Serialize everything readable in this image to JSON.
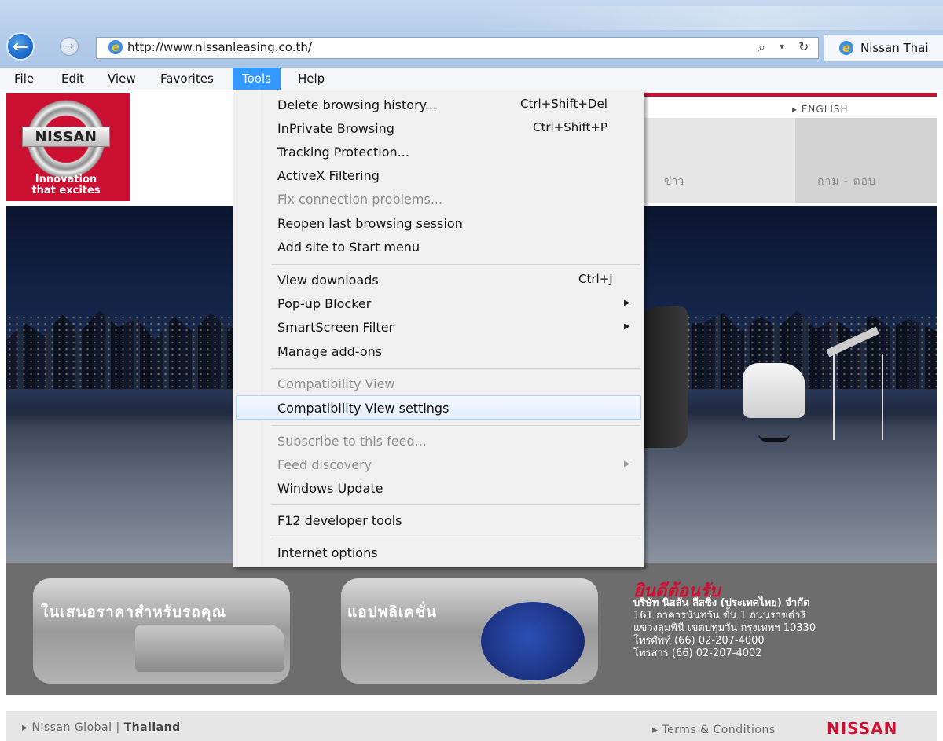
{
  "browser": {
    "url": "http://www.nissanleasing.co.th/",
    "tab_title": "Nissan Thai"
  },
  "menubar": {
    "items": [
      "File",
      "Edit",
      "View",
      "Favorites",
      "Tools",
      "Help"
    ]
  },
  "tools_menu": {
    "items": [
      {
        "label": "Delete browsing history...",
        "shortcut": "Ctrl+Shift+Del"
      },
      {
        "label": "InPrivate Browsing",
        "shortcut": "Ctrl+Shift+P"
      },
      {
        "label": "Tracking Protection..."
      },
      {
        "label": "ActiveX Filtering"
      },
      {
        "label": "Fix connection problems...",
        "disabled": true
      },
      {
        "label": "Reopen last browsing session"
      },
      {
        "label": "Add site to Start menu"
      },
      {
        "label": "View downloads",
        "shortcut": "Ctrl+J"
      },
      {
        "label": "Pop-up Blocker",
        "submenu": true
      },
      {
        "label": "SmartScreen Filter",
        "submenu": true
      },
      {
        "label": "Manage add-ons"
      },
      {
        "label": "Compatibility View",
        "disabled": true
      },
      {
        "label": "Compatibility View settings",
        "highlighted": true
      },
      {
        "label": "Subscribe to this feed...",
        "disabled": true
      },
      {
        "label": "Feed discovery",
        "disabled": true,
        "submenu": true
      },
      {
        "label": "Windows Update"
      },
      {
        "label": "F12 developer tools"
      },
      {
        "label": "Internet options"
      }
    ]
  },
  "page": {
    "logo_text": "NISSAN",
    "tagline_1": "Innovation",
    "tagline_2": "that excites",
    "english_link": "▸ ENGLISH",
    "nav_news": "ข่าว",
    "nav_qa": "ถาม - ตอบ",
    "promo1_title": "ในเสนอราคาสำหรับรถคุณ",
    "promo2_title": "แอปพลิเคชั่น",
    "welcome": "ยินดีต้อนรับ",
    "company_lines": [
      "บริษัท นิสสัน ลีสซิ่ง (ประเทศไทย) จำกัด",
      "161 อาคารนันทวัน ชั้น 1 ถนนราชดำริ",
      "แขวงลุมพินี เขตปทุมวัน กรุงเทพฯ 10330",
      "โทรศัพท์ (66) 02-207-4000",
      "โทรสาร (66) 02-207-4002"
    ],
    "footer_global": "▸ Nissan Global",
    "footer_sep": "|",
    "footer_thailand": "Thailand",
    "footer_terms": "▸ Terms & Conditions",
    "footer_brand": "NISSAN"
  },
  "colors": {
    "nissan_red": "#cc1031",
    "menu_highlight": "#3399ff"
  }
}
